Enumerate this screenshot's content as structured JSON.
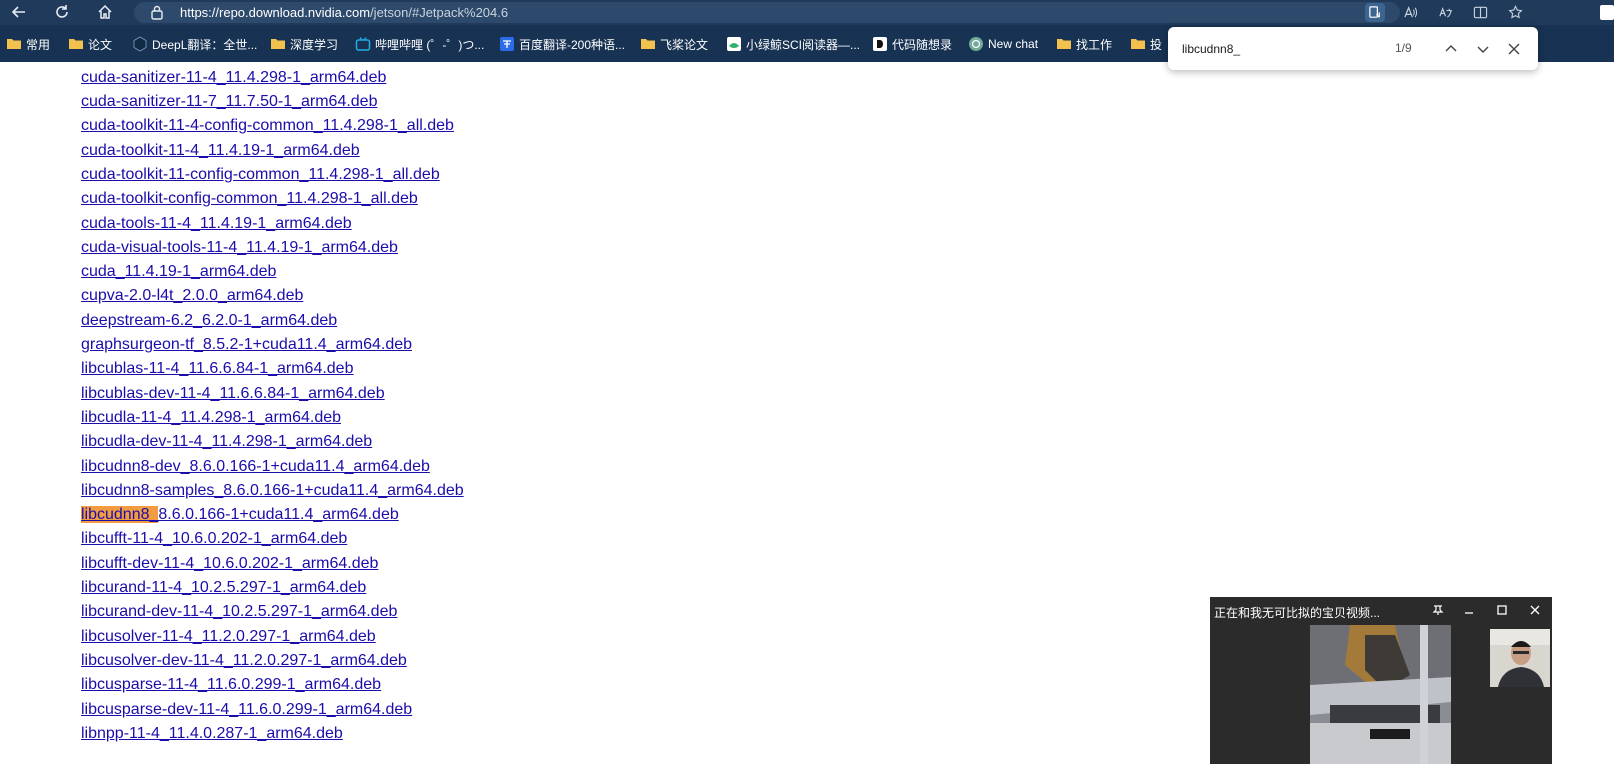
{
  "browser": {
    "url_main": "https://repo.download.nvidia.com",
    "url_rest": "/jetson/#Jetpack%204.6",
    "icons": [
      "back-icon",
      "refresh-icon",
      "home-icon",
      "lock-icon",
      "read-mode-icon",
      "read-aloud-icon",
      "translate-icon",
      "split-screen-icon",
      "favorites-star-icon"
    ]
  },
  "favorites": [
    {
      "label": "常用",
      "icon": "folder-icon"
    },
    {
      "label": "论文",
      "icon": "folder-icon"
    },
    {
      "label": "DeepL翻译：全世...",
      "icon": "deepl-icon"
    },
    {
      "label": "深度学习",
      "icon": "folder-icon"
    },
    {
      "label": "哔哩哔哩 (゜-゜)つ...",
      "icon": "bilibili-icon"
    },
    {
      "label": "百度翻译-200种语...",
      "icon": "baidu-translate-icon"
    },
    {
      "label": "飞桨论文",
      "icon": "folder-icon"
    },
    {
      "label": "小绿鲸SCI阅读器—...",
      "icon": "whale-icon"
    },
    {
      "label": "代码随想录",
      "icon": "code-icon"
    },
    {
      "label": "New chat",
      "icon": "chatgpt-icon"
    },
    {
      "label": "找工作",
      "icon": "folder-icon"
    },
    {
      "label": "投",
      "icon": "folder-icon"
    }
  ],
  "files": [
    "cuda-sanitizer-11-4_11.4.298-1_arm64.deb",
    "cuda-sanitizer-11-7_11.7.50-1_arm64.deb",
    "cuda-toolkit-11-4-config-common_11.4.298-1_all.deb",
    "cuda-toolkit-11-4_11.4.19-1_arm64.deb",
    "cuda-toolkit-11-config-common_11.4.298-1_all.deb",
    "cuda-toolkit-config-common_11.4.298-1_all.deb",
    "cuda-tools-11-4_11.4.19-1_arm64.deb",
    "cuda-visual-tools-11-4_11.4.19-1_arm64.deb",
    "cuda_11.4.19-1_arm64.deb",
    "cupva-2.0-l4t_2.0.0_arm64.deb",
    "deepstream-6.2_6.2.0-1_arm64.deb",
    "graphsurgeon-tf_8.5.2-1+cuda11.4_arm64.deb",
    "libcublas-11-4_11.6.6.84-1_arm64.deb",
    "libcublas-dev-11-4_11.6.6.84-1_arm64.deb",
    "libcudla-11-4_11.4.298-1_arm64.deb",
    "libcudla-dev-11-4_11.4.298-1_arm64.deb",
    "libcudnn8-dev_8.6.0.166-1+cuda11.4_arm64.deb",
    "libcudnn8-samples_8.6.0.166-1+cuda11.4_arm64.deb",
    "libcudnn8_8.6.0.166-1+cuda11.4_arm64.deb",
    "libcufft-11-4_10.6.0.202-1_arm64.deb",
    "libcufft-dev-11-4_10.6.0.202-1_arm64.deb",
    "libcurand-11-4_10.2.5.297-1_arm64.deb",
    "libcurand-dev-11-4_10.2.5.297-1_arm64.deb",
    "libcusolver-11-4_11.2.0.297-1_arm64.deb",
    "libcusolver-dev-11-4_11.2.0.297-1_arm64.deb",
    "libcusparse-11-4_11.6.0.299-1_arm64.deb",
    "libcusparse-dev-11-4_11.6.0.299-1_arm64.deb",
    "libnpp-11-4_11.4.0.287-1_arm64.deb"
  ],
  "highlight": {
    "file_index": 18,
    "text": "libcudnn8_"
  },
  "find_bar": {
    "value": "libcudnn8_",
    "count": "1/9",
    "icons": [
      "previous-match-icon",
      "next-match-icon",
      "close-icon"
    ]
  },
  "video_call": {
    "title": "正在和我无可比拟的宝贝视频...",
    "icons": [
      "pin-icon",
      "minimize-icon",
      "maximize-icon",
      "close-icon"
    ]
  },
  "colors": {
    "tab_bar": "#1f3a5a",
    "favorites_bar": "#173252",
    "link": "#1a0dab",
    "find_highlight": "#f39b40"
  }
}
